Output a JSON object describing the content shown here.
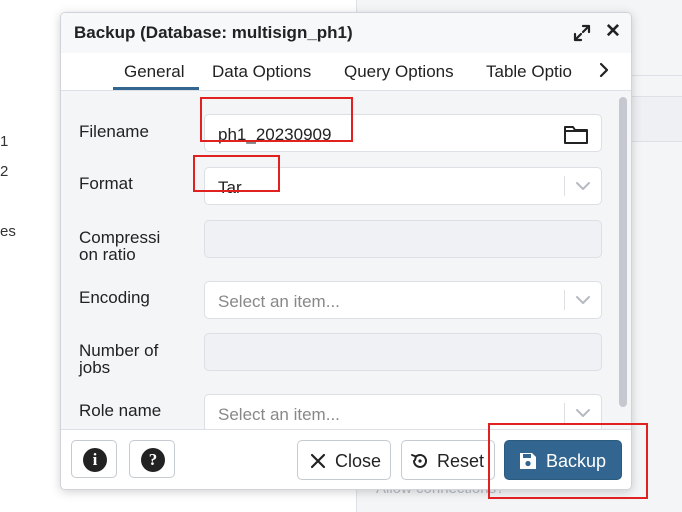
{
  "background": {
    "left_fragments": [
      "1",
      "2",
      "es"
    ],
    "ghost_text": "Allow connections?"
  },
  "dialog": {
    "title": "Backup (Database: multisign_ph1)",
    "tabs": [
      "General",
      "Data Options",
      "Query Options",
      "Table Optio"
    ],
    "active_tab": "General",
    "fields": {
      "filename": {
        "label": "Filename",
        "value": "ph1_20230909"
      },
      "format": {
        "label": "Format",
        "value": "Tar"
      },
      "compression": {
        "label_line1": "Compressi",
        "label_line2": "on ratio",
        "value": ""
      },
      "encoding": {
        "label": "Encoding",
        "placeholder": "Select an item..."
      },
      "jobs": {
        "label_line1": "Number of",
        "label_line2": "jobs",
        "value": ""
      },
      "role": {
        "label": "Role name",
        "placeholder": "Select an item..."
      }
    },
    "footer": {
      "info_glyph": "i",
      "help_glyph": "?",
      "close_label": "Close",
      "reset_label": "Reset",
      "backup_label": "Backup"
    }
  },
  "colors": {
    "primary": "#326690",
    "annotation": "#e0211f",
    "panel_bg": "#f4f5f7"
  },
  "icons": [
    "expand-icon",
    "close-icon",
    "chevron-right-icon",
    "folder-icon",
    "chevron-down-icon",
    "info-icon",
    "help-icon",
    "x-icon",
    "reset-icon",
    "save-icon"
  ]
}
